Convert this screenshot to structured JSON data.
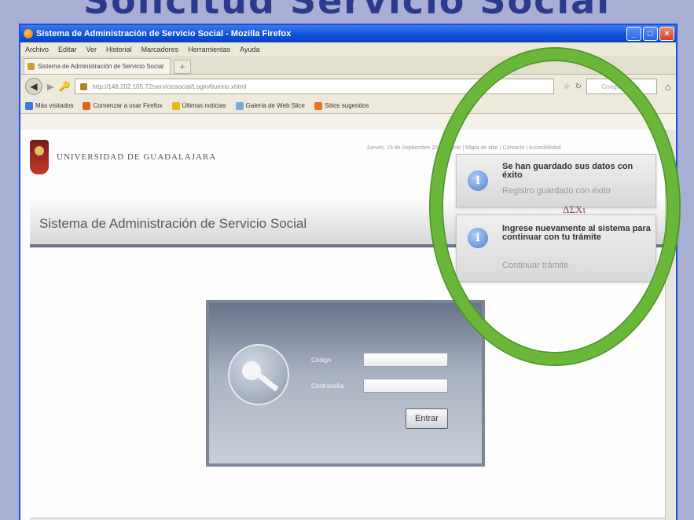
{
  "slide": {
    "title": "Solicitud Servicio Social"
  },
  "window": {
    "title": "Sistema de Administración de Servicio Social - Mozilla Firefox",
    "buttons": {
      "minimize": "_",
      "maximize": "□",
      "close": "×"
    }
  },
  "menu": {
    "items": [
      "Archivo",
      "Editar",
      "Ver",
      "Historial",
      "Marcadores",
      "Herramientas",
      "Ayuda"
    ]
  },
  "tabs": [
    {
      "label": "Sistema de Administración de Servicio Social"
    }
  ],
  "new_tab": "+",
  "url": {
    "value": "http://148.202.105.72/serviciosocial/LoginAlumno.xhtml",
    "search_placeholder": "Google"
  },
  "bookmarks": [
    {
      "label": "Más visitados",
      "color": "#3b7ad8"
    },
    {
      "label": "Comenzar a usar Firefox",
      "color": "#e2641a"
    },
    {
      "label": "Últimas noticias",
      "color": "#f0b323"
    },
    {
      "label": "Galería de Web Slice",
      "color": "#7aa7e0"
    },
    {
      "label": "Sitios sugeridos",
      "color": "#e8741c"
    }
  ],
  "page": {
    "university": "UNIVERSIDAD DE GUADALAJARA",
    "top_links": "Jueves, 15 de Septiembre 2011 | Inicio | Mapa de sitio | Contacto | Accesibilidad",
    "system_title": "Sistema de Administración de Servicio Social",
    "login": {
      "code_label": "Código",
      "password_label": "Contraseña",
      "code_value": "",
      "password_value": "",
      "enter_label": "Entrar"
    }
  },
  "notifications": [
    {
      "title": "Se han guardado sus datos con éxito",
      "subtitle": "Registro guardado con éxito"
    },
    {
      "title": "Ingrese nuevamente al sistema para continuar con tu trámite",
      "subtitle": "Continuar trámite"
    }
  ],
  "mark_text": "ΔΣΧι",
  "colors": {
    "highlight_ring": "#6ab73a",
    "titlebar": "#0d4fd6"
  }
}
